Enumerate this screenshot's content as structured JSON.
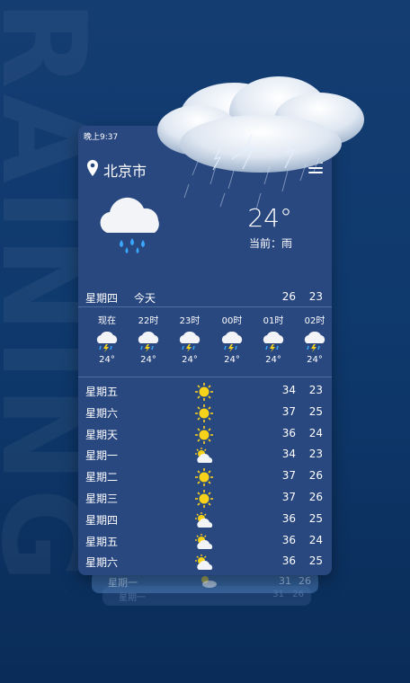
{
  "background_word": "RAINING",
  "status_bar": {
    "time": "晚上9:37"
  },
  "header": {
    "city": "北京市",
    "location_icon": "location-pin-icon",
    "menu_icon": "menu-icon"
  },
  "current": {
    "temperature": "24°",
    "condition": "当前：雨",
    "icon": "rain-cloud-icon"
  },
  "today": {
    "day": "星期四",
    "label": "今天",
    "high": "26",
    "low": "23"
  },
  "hourly": [
    {
      "time": "现在",
      "icon": "thunder-rain-icon",
      "temp": "24°"
    },
    {
      "time": "22时",
      "icon": "thunder-rain-icon",
      "temp": "24°"
    },
    {
      "time": "23时",
      "icon": "thunder-rain-icon",
      "temp": "24°"
    },
    {
      "time": "00时",
      "icon": "thunder-rain-icon",
      "temp": "24°"
    },
    {
      "time": "01时",
      "icon": "thunder-rain-icon",
      "temp": "24°"
    },
    {
      "time": "02时",
      "icon": "thunder-rain-icon",
      "temp": "24°"
    }
  ],
  "daily": [
    {
      "day": "星期五",
      "icon": "sunny-icon",
      "high": "34",
      "low": "23"
    },
    {
      "day": "星期六",
      "icon": "sunny-icon",
      "high": "37",
      "low": "25"
    },
    {
      "day": "星期天",
      "icon": "sunny-icon",
      "high": "36",
      "low": "24"
    },
    {
      "day": "星期一",
      "icon": "partly-cloudy-icon",
      "high": "34",
      "low": "23"
    },
    {
      "day": "星期二",
      "icon": "sunny-icon",
      "high": "37",
      "low": "26"
    },
    {
      "day": "星期三",
      "icon": "sunny-icon",
      "high": "37",
      "low": "26"
    },
    {
      "day": "星期四",
      "icon": "partly-cloudy-icon",
      "high": "36",
      "low": "25"
    },
    {
      "day": "星期五",
      "icon": "partly-cloudy-icon",
      "high": "36",
      "low": "24"
    },
    {
      "day": "星期六",
      "icon": "partly-cloudy-icon",
      "high": "36",
      "low": "25"
    }
  ],
  "stacked_cards": [
    {
      "day": "星期一",
      "high": "31",
      "low": "26"
    },
    {
      "day": "星期一",
      "high": "31",
      "low": "26"
    }
  ],
  "colors": {
    "card": "#2a4880",
    "background": "#0f3a6e",
    "rain": "#39a7ff",
    "sun": "#f7d21b"
  }
}
